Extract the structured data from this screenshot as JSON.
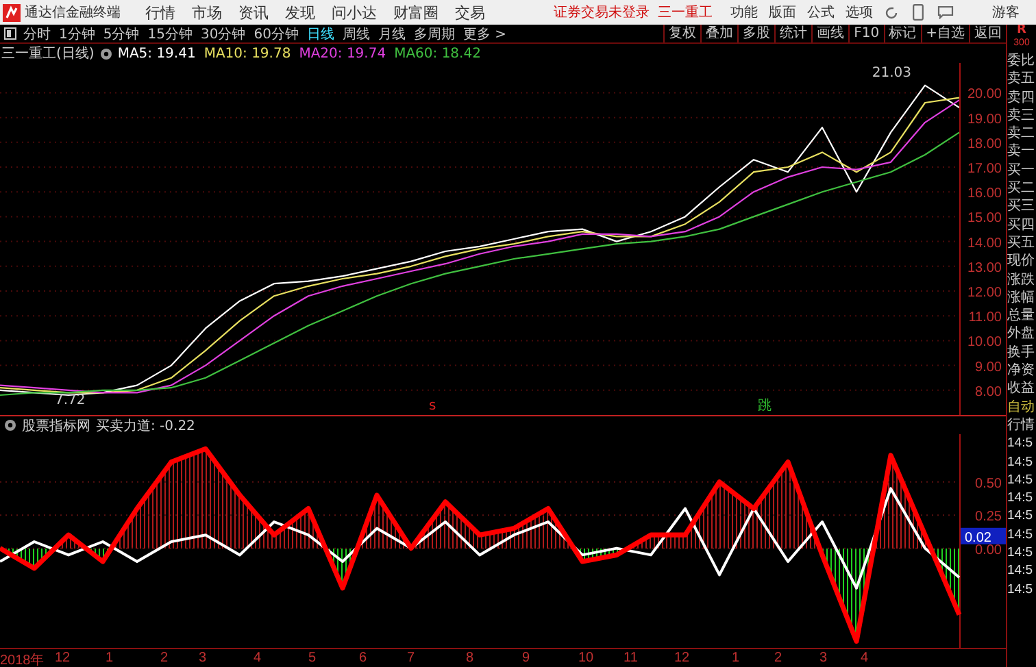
{
  "app": {
    "name": "通达信金融终端"
  },
  "menu": [
    "行情",
    "市场",
    "资讯",
    "发现",
    "问小达",
    "财富圈",
    "交易"
  ],
  "login_notice": "证券交易未登录",
  "stock_name": "三一重工",
  "right_menu": [
    "功能",
    "版面",
    "公式",
    "选项"
  ],
  "user": "游客",
  "periods": [
    {
      "label": "分时",
      "selected": false
    },
    {
      "label": "1分钟",
      "selected": false
    },
    {
      "label": "5分钟",
      "selected": false
    },
    {
      "label": "15分钟",
      "selected": false
    },
    {
      "label": "30分钟",
      "selected": false
    },
    {
      "label": "60分钟",
      "selected": false
    },
    {
      "label": "日线",
      "selected": true
    },
    {
      "label": "周线",
      "selected": false
    },
    {
      "label": "月线",
      "selected": false
    },
    {
      "label": "多周期",
      "selected": false
    },
    {
      "label": "更多 >",
      "selected": false
    }
  ],
  "tools": [
    "复权",
    "叠加",
    "多股",
    "统计",
    "画线",
    "F10",
    "标记",
    "+自选",
    "返回"
  ],
  "r_badge": {
    "letter": "R",
    "number": "300"
  },
  "main_chart": {
    "title": "三一重工(日线)",
    "ma_legend": [
      "19.41",
      "19.78",
      "19.74",
      "18.42"
    ],
    "high_label": "21.03",
    "low_label": "7.72",
    "signals": [
      {
        "text": "s",
        "color": "#e02020"
      },
      {
        "text": "跳",
        "color": "#30c030"
      }
    ],
    "chart_data": {
      "type": "line",
      "grid": true,
      "ylim": [
        7,
        21.2
      ],
      "yticks": [
        {
          "value": 8,
          "label": "8.00"
        },
        {
          "value": 9,
          "label": "9.00"
        },
        {
          "value": 10,
          "label": "10.00"
        },
        {
          "value": 11,
          "label": "11.00"
        },
        {
          "value": 12,
          "label": "12.00"
        },
        {
          "value": 13,
          "label": "13.00"
        },
        {
          "value": 14,
          "label": "14.00"
        },
        {
          "value": 15,
          "label": "15.00"
        },
        {
          "value": 16,
          "label": "16.00"
        },
        {
          "value": 17,
          "label": "17.00"
        },
        {
          "value": 18,
          "label": "18.00"
        },
        {
          "value": 19,
          "label": "19.00"
        },
        {
          "value": 20,
          "label": "20.00"
        }
      ],
      "series": [
        {
          "name": "MA5:",
          "color": "#ffffff",
          "values": [
            8.0,
            7.9,
            7.8,
            7.9,
            8.2,
            9.0,
            10.5,
            11.6,
            12.3,
            12.4,
            12.6,
            12.9,
            13.2,
            13.6,
            13.8,
            14.1,
            14.4,
            14.5,
            14.0,
            14.4,
            15.0,
            16.2,
            17.3,
            16.8,
            18.6,
            16.0,
            18.4,
            20.3,
            19.4
          ]
        },
        {
          "name": "MA10:",
          "color": "#e8e060",
          "values": [
            8.1,
            8.0,
            7.9,
            7.9,
            8.0,
            8.5,
            9.6,
            10.8,
            11.8,
            12.2,
            12.5,
            12.7,
            13.0,
            13.4,
            13.7,
            13.9,
            14.2,
            14.4,
            14.2,
            14.2,
            14.7,
            15.6,
            16.8,
            17.0,
            17.6,
            16.8,
            17.6,
            19.6,
            19.8
          ]
        },
        {
          "name": "MA20:",
          "color": "#e040e0",
          "values": [
            8.2,
            8.1,
            8.0,
            7.9,
            7.9,
            8.2,
            9.0,
            10.0,
            11.0,
            11.8,
            12.2,
            12.5,
            12.8,
            13.1,
            13.5,
            13.8,
            14.0,
            14.3,
            14.3,
            14.2,
            14.4,
            15.0,
            16.0,
            16.6,
            17.0,
            16.9,
            17.2,
            18.8,
            19.7
          ]
        },
        {
          "name": "MA60:",
          "color": "#40c040",
          "values": [
            7.8,
            7.9,
            7.9,
            8.0,
            8.0,
            8.1,
            8.5,
            9.2,
            9.9,
            10.6,
            11.2,
            11.8,
            12.3,
            12.7,
            13.0,
            13.3,
            13.5,
            13.7,
            13.9,
            14.0,
            14.2,
            14.5,
            15.0,
            15.5,
            16.0,
            16.4,
            16.8,
            17.5,
            18.4
          ]
        }
      ]
    }
  },
  "indicator": {
    "source": "股票指标网",
    "reading": "-0.22",
    "current_value": "0.02",
    "chart_data": {
      "type": "line",
      "grid": true,
      "ylim": [
        -0.75,
        0.86
      ],
      "yticks": [
        {
          "value": 0,
          "label": "0.00"
        },
        {
          "value": 0.25,
          "label": "0.25"
        },
        {
          "value": 0.5,
          "label": "0.50"
        }
      ],
      "series": [
        {
          "name": "买卖力道:",
          "color": "#ffffff",
          "values": [
            -0.1,
            0.05,
            -0.05,
            0.05,
            -0.1,
            0.05,
            0.1,
            -0.05,
            0.2,
            0.1,
            -0.1,
            0.15,
            0.0,
            0.2,
            -0.05,
            0.1,
            0.2,
            -0.05,
            0.0,
            -0.05,
            0.3,
            -0.2,
            0.3,
            -0.1,
            0.2,
            -0.3,
            0.45,
            0.0,
            -0.22
          ]
        },
        {
          "color": "#ff0000",
          "values": [
            0.0,
            -0.15,
            0.1,
            -0.1,
            0.3,
            0.65,
            0.75,
            0.4,
            0.1,
            0.3,
            -0.3,
            0.4,
            0.0,
            0.35,
            0.1,
            0.15,
            0.3,
            -0.1,
            -0.05,
            0.1,
            0.1,
            0.5,
            0.3,
            0.65,
            -0.05,
            -0.7,
            0.7,
            0.1,
            -0.5
          ]
        }
      ]
    }
  },
  "x_axis": [
    "2018年",
    "12",
    "1",
    "2",
    "3",
    "4",
    "5",
    "6",
    "7",
    "8",
    "9",
    "10",
    "11",
    "12",
    "1",
    "2",
    "3",
    "4"
  ],
  "quote_panel": {
    "fields": [
      "委比",
      "卖五",
      "卖四",
      "卖三",
      "卖二",
      "卖一",
      "买一",
      "买二",
      "买三",
      "买四",
      "买五",
      "现价",
      "涨跌",
      "涨幅",
      "总量",
      "外盘",
      "换手",
      "净资",
      "收益"
    ],
    "auto": "自动",
    "quotes": "行情",
    "times": [
      "14:5",
      "14:5",
      "14:5",
      "14:5",
      "14:5",
      "14:5",
      "14:5",
      "14:5",
      "14:5"
    ]
  }
}
